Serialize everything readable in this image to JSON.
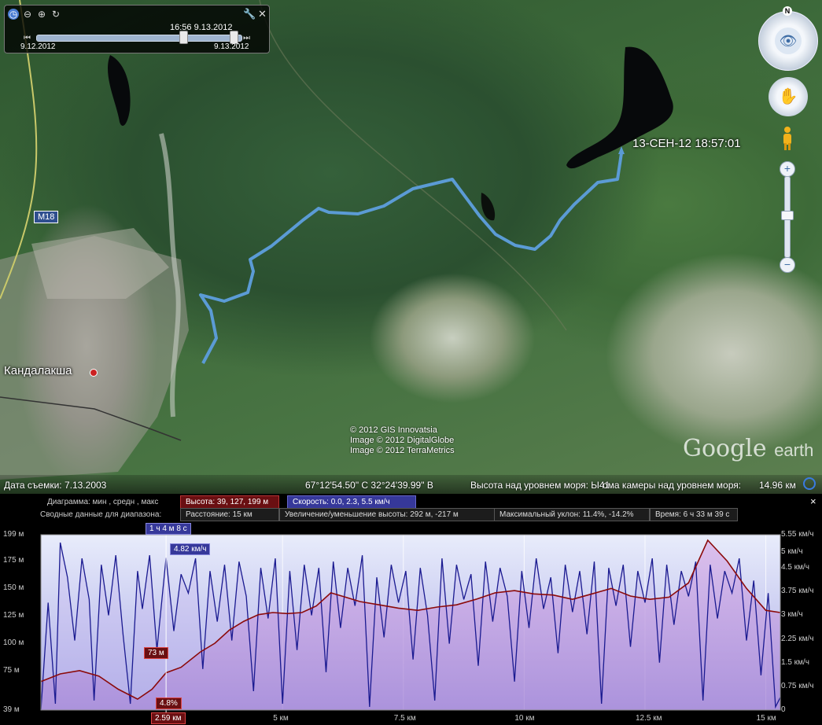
{
  "map": {
    "credits": [
      "© 2012 GIS Innovatsia",
      "Image © 2012 DigitalGlobe",
      "Image © 2012 TerraMetrics"
    ],
    "watermark": "Google",
    "watermark_suffix": "earth",
    "city_label": "Кандалакша",
    "road_label": "M18",
    "track_label": "13-СЕН-12 18:57:01",
    "track_color": "#5b9bd5"
  },
  "time_slider": {
    "current_time": "16:56 9.13.2012",
    "start_date": "9.12.2012",
    "end_date": "9.13.2012",
    "position": 0.96
  },
  "navigation": {
    "north_label": "N"
  },
  "status_bar": {
    "imagery_date": "Дата съемки: 7.13.2003",
    "coordinates": "67°12'54.50\" С   32°24'39.99\" В",
    "elevation": "Высота над уровнем моря:  Ы41",
    "eye_alt_label": "ома камеры над уровнем моря:",
    "eye_alt_value": "14.96 км"
  },
  "profile": {
    "close_label": "×",
    "graph_label": "Диаграмма: мин , средн , макс",
    "altitude_summary": "Высота: 39, 127, 199 м",
    "speed_summary": "Скорость: 0.0, 2.3, 5.5 км/ч",
    "range_label": "Сводные данные для диапазона:",
    "distance": "Расстояние: 15 км",
    "elevation_change": "Увеличение/уменьшение высоты: 292 м, -217 м",
    "max_slope": "Максимальный уклон: 11.4%, -14.2%",
    "time": "Время: 6 ч 33 м 39 с",
    "cursor_time": "1 ч 4 м 8 с",
    "cursor_speed": "4.82 км/ч",
    "cursor_altitude": "73 м",
    "cursor_slope": "4.8%",
    "cursor_distance": "2.59 км",
    "altitude_color": "#8b0a0a",
    "speed_color": "#1a1a90"
  },
  "chart_data": {
    "type": "line",
    "xlabel": "",
    "ylabel": "",
    "x_ticks": [
      "5 км",
      "7.5 км",
      "10 км",
      "12.5 км",
      "15 км"
    ],
    "x_tick_values": [
      5,
      7.5,
      10,
      12.5,
      15
    ],
    "xlim": [
      0,
      15.3
    ],
    "y_left_ticks": [
      "199 м",
      "175 м",
      "150 м",
      "125 м",
      "100 м",
      "75 м",
      "39 м"
    ],
    "y_left_tick_values": [
      199,
      175,
      150,
      125,
      100,
      75,
      39
    ],
    "ylim_left": [
      39,
      199
    ],
    "y_right_ticks": [
      "5.55 км/ч",
      "5 км/ч",
      "4.5 км/ч",
      "3.75 км/ч",
      "3 км/ч",
      "2.25 км/ч",
      "1.5 км/ч",
      "0.75 км/ч",
      "0"
    ],
    "y_right_tick_values": [
      5.55,
      5,
      4.5,
      3.75,
      3,
      2.25,
      1.5,
      0.75,
      0
    ],
    "ylim_right": [
      0,
      5.55
    ],
    "cursor_x": 2.59,
    "series": [
      {
        "axis": "left",
        "x": [
          0,
          0.4,
          0.8,
          1.2,
          1.6,
          2.0,
          2.3,
          2.59,
          2.9,
          3.3,
          3.6,
          3.9,
          4.2,
          4.5,
          4.8,
          5.1,
          5.4,
          5.7,
          6.0,
          6.3,
          6.6,
          7.0,
          7.4,
          7.8,
          8.2,
          8.6,
          9.0,
          9.4,
          9.8,
          10.2,
          10.6,
          11.0,
          11.4,
          11.8,
          12.2,
          12.6,
          13.0,
          13.4,
          13.8,
          14.2,
          14.6,
          15.0,
          15.3
        ],
        "values": [
          65,
          72,
          75,
          70,
          58,
          49,
          58,
          73,
          78,
          92,
          100,
          112,
          120,
          126,
          128,
          127,
          128,
          134,
          146,
          142,
          138,
          135,
          132,
          130,
          133,
          135,
          140,
          146,
          148,
          145,
          144,
          140,
          145,
          150,
          143,
          140,
          142,
          155,
          194,
          175,
          150,
          130,
          128
        ]
      },
      {
        "axis": "right",
        "x": [
          0,
          0.15,
          0.3,
          0.4,
          0.55,
          0.7,
          0.85,
          1.0,
          1.1,
          1.25,
          1.4,
          1.55,
          1.7,
          1.85,
          2.0,
          2.1,
          2.25,
          2.4,
          2.59,
          2.75,
          2.9,
          3.05,
          3.2,
          3.35,
          3.5,
          3.65,
          3.8,
          3.95,
          4.1,
          4.25,
          4.4,
          4.55,
          4.7,
          4.85,
          5.0,
          5.15,
          5.3,
          5.45,
          5.6,
          5.75,
          5.9,
          6.05,
          6.2,
          6.35,
          6.5,
          6.65,
          6.8,
          6.95,
          7.1,
          7.25,
          7.4,
          7.55,
          7.7,
          7.85,
          8.0,
          8.15,
          8.3,
          8.45,
          8.6,
          8.75,
          8.9,
          9.05,
          9.2,
          9.35,
          9.5,
          9.65,
          9.8,
          9.95,
          10.1,
          10.25,
          10.4,
          10.55,
          10.7,
          10.85,
          11.0,
          11.15,
          11.3,
          11.45,
          11.6,
          11.75,
          11.9,
          12.05,
          12.2,
          12.35,
          12.5,
          12.65,
          12.8,
          12.95,
          13.1,
          13.25,
          13.4,
          13.55,
          13.7,
          13.85,
          14.0,
          14.15,
          14.3,
          14.45,
          14.6,
          14.75,
          14.9,
          15.05,
          15.2,
          15.3
        ],
        "values": [
          0,
          3.4,
          0.2,
          5.3,
          4.2,
          2.2,
          4.8,
          3.5,
          0.3,
          4.6,
          3.0,
          4.9,
          2.4,
          0.2,
          4.4,
          3.2,
          4.9,
          1.9,
          4.82,
          2.5,
          4.3,
          3.7,
          4.8,
          1.3,
          4.4,
          2.8,
          4.6,
          2.2,
          4.7,
          3.6,
          0.6,
          4.5,
          2.9,
          4.8,
          0.2,
          4.4,
          1.9,
          4.6,
          3.0,
          4.5,
          1.2,
          4.7,
          2.6,
          4.5,
          3.3,
          4.9,
          0.1,
          4.2,
          2.3,
          4.6,
          3.4,
          4.4,
          1.6,
          4.5,
          3.0,
          0.3,
          4.8,
          2.1,
          4.6,
          3.5,
          4.3,
          1.4,
          4.7,
          2.8,
          4.5,
          3.6,
          0.9,
          4.4,
          2.6,
          4.8,
          3.2,
          4.2,
          1.8,
          4.6,
          3.1,
          4.4,
          2.4,
          4.7,
          0.2,
          4.5,
          3.3,
          4.6,
          2.0,
          4.4,
          3.4,
          4.8,
          1.5,
          4.6,
          2.7,
          4.4,
          3.6,
          4.7,
          0.3,
          4.6,
          2.9,
          4.4,
          3.7,
          4.8,
          2.2,
          4.1,
          1.1,
          3.7,
          0.1,
          0.4
        ]
      }
    ]
  }
}
